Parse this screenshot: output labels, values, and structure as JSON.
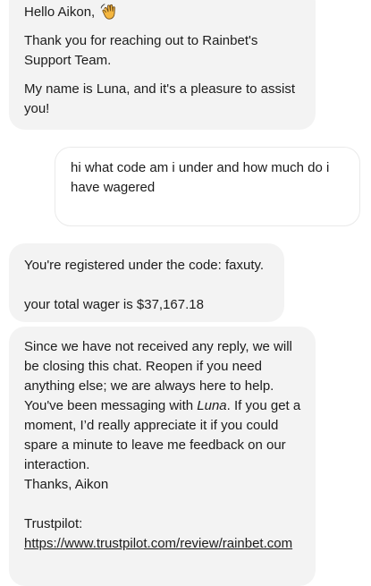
{
  "messages": {
    "agent_greeting": {
      "hello": "Hello Aikon,",
      "thanks": "Thank you for reaching out to Rainbet's Support Team.",
      "intro": "My name is Luna, and it's a pleasure to assist you!"
    },
    "user_question": {
      "text": "hi what code am i under and how much do i have wagered"
    },
    "agent_answer": {
      "text": "You're registered under the code: faxuty.\n\nyour total wager is $37,167.18"
    },
    "agent_closing": {
      "before_name": "Since we have not received any reply, we will be closing this chat. Reopen if you need anything else; we are always here to help. You've been messaging with ",
      "agent_name": "Luna",
      "after_name": ". If you get a moment, I’d really appreciate it if you could spare a minute to leave me feedback on our interaction.",
      "signoff": "Thanks, Aikon",
      "trustpilot_label": "Trustpilot:",
      "trustpilot_url": "https://www.trustpilot.com/review/rainbet.com"
    }
  },
  "icons": {
    "wave": "waving-hand-icon"
  },
  "colors": {
    "agent_bubble": "#f3f3f3",
    "user_bubble": "#ffffff",
    "user_border": "#eaeaea",
    "text": "#1c1c1c"
  }
}
